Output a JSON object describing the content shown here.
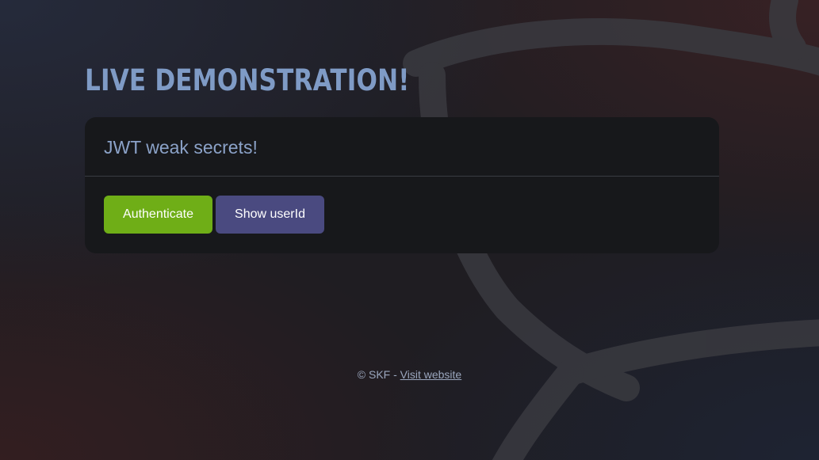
{
  "page": {
    "heading": "LIVE DEMONSTRATION!"
  },
  "card": {
    "title": "JWT weak secrets!",
    "buttons": {
      "authenticate_label": "Authenticate",
      "show_userid_label": "Show userId"
    }
  },
  "footer": {
    "copyright": "© SKF - ",
    "link_text": "Visit website"
  },
  "colors": {
    "heading": "#7f9bc6",
    "card_background": "#17181b",
    "authenticate_button": "#6fae17",
    "show_userid_button": "#4a4a80"
  },
  "icons": {
    "background": "skf-logo-watermark"
  }
}
